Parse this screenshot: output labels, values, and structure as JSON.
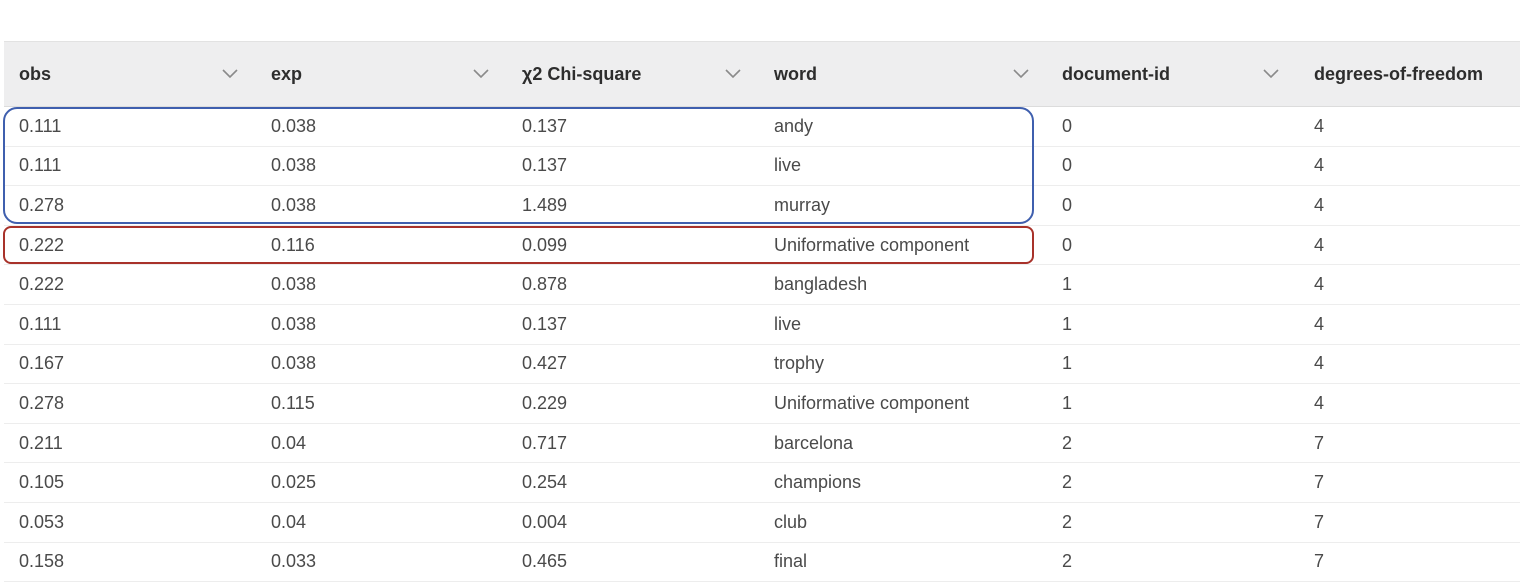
{
  "table": {
    "columns": [
      {
        "label": "obs",
        "sortable": true
      },
      {
        "label": "exp",
        "sortable": true
      },
      {
        "label": "χ2 Chi-square",
        "sortable": true
      },
      {
        "label": "word",
        "sortable": true
      },
      {
        "label": "document-id",
        "sortable": true
      },
      {
        "label": "degrees-of-freedom",
        "sortable": false
      }
    ],
    "rows": [
      [
        "0.111",
        "0.038",
        "0.137",
        "andy",
        "0",
        "4"
      ],
      [
        "0.111",
        "0.038",
        "0.137",
        "live",
        "0",
        "4"
      ],
      [
        "0.278",
        "0.038",
        "1.489",
        "murray",
        "0",
        "4"
      ],
      [
        "0.222",
        "0.116",
        "0.099",
        "Uniformative component",
        "0",
        "4"
      ],
      [
        "0.222",
        "0.038",
        "0.878",
        "bangladesh",
        "1",
        "4"
      ],
      [
        "0.111",
        "0.038",
        "0.137",
        "live",
        "1",
        "4"
      ],
      [
        "0.167",
        "0.038",
        "0.427",
        "trophy",
        "1",
        "4"
      ],
      [
        "0.278",
        "0.115",
        "0.229",
        "Uniformative component",
        "1",
        "4"
      ],
      [
        "0.211",
        "0.04",
        "0.717",
        "barcelona",
        "2",
        "7"
      ],
      [
        "0.105",
        "0.025",
        "0.254",
        "champions",
        "2",
        "7"
      ],
      [
        "0.053",
        "0.04",
        "0.004",
        "club",
        "2",
        "7"
      ],
      [
        "0.158",
        "0.033",
        "0.465",
        "final",
        "2",
        "7"
      ]
    ],
    "sort_icon": "chevron-down-icon"
  },
  "annotations": {
    "blue_box": {
      "color": "#3f5fae",
      "covers_rows": [
        0,
        1,
        2
      ]
    },
    "red_box": {
      "color": "#a8322a",
      "covers_rows": [
        3
      ]
    }
  },
  "colors": {
    "header_bg": "#eeeeef",
    "header_text": "#2d2d2d",
    "cell_text": "#4a4a4a"
  }
}
